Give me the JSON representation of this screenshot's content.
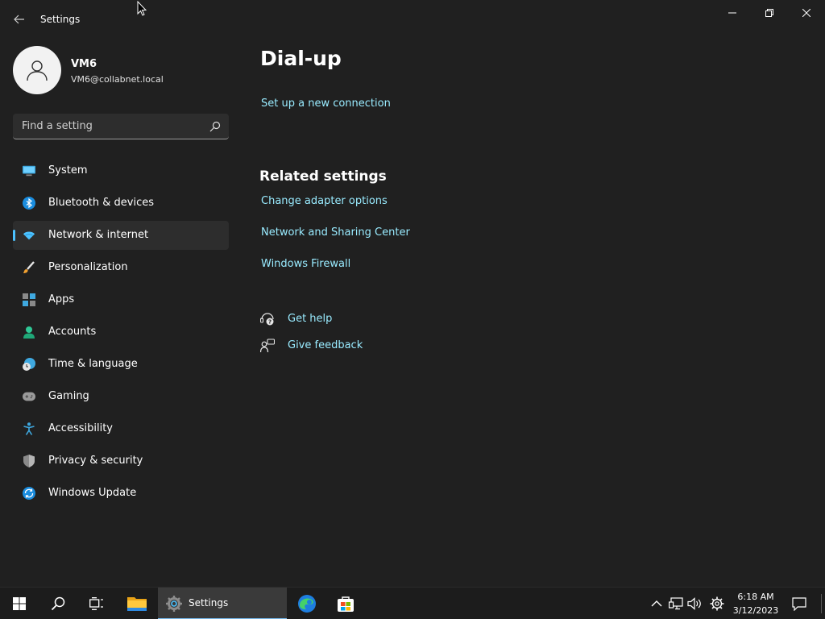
{
  "window": {
    "title": "Settings"
  },
  "profile": {
    "name": "VM6",
    "email": "VM6@collabnet.local"
  },
  "search": {
    "placeholder": "Find a setting"
  },
  "nav": {
    "items": [
      {
        "label": "System",
        "icon": "monitor-icon"
      },
      {
        "label": "Bluetooth & devices",
        "icon": "bluetooth-icon"
      },
      {
        "label": "Network & internet",
        "icon": "wifi-icon",
        "active": true
      },
      {
        "label": "Personalization",
        "icon": "brush-icon"
      },
      {
        "label": "Apps",
        "icon": "apps-icon"
      },
      {
        "label": "Accounts",
        "icon": "person-icon"
      },
      {
        "label": "Time & language",
        "icon": "clock-globe-icon"
      },
      {
        "label": "Gaming",
        "icon": "gamepad-icon"
      },
      {
        "label": "Accessibility",
        "icon": "accessibility-icon"
      },
      {
        "label": "Privacy & security",
        "icon": "shield-icon"
      },
      {
        "label": "Windows Update",
        "icon": "update-icon"
      }
    ]
  },
  "content": {
    "title": "Dial-up",
    "setup_link": "Set up a new connection",
    "related_title": "Related settings",
    "related_links": [
      "Change adapter options",
      "Network and Sharing Center",
      "Windows Firewall"
    ],
    "help": {
      "get_help": "Get help",
      "give_feedback": "Give feedback"
    }
  },
  "taskbar": {
    "settings_label": "Settings",
    "time": "6:18 AM",
    "date": "3/12/2023"
  },
  "colors": {
    "background": "#202020",
    "link": "#99ebff",
    "accent": "#4cc2ff"
  }
}
